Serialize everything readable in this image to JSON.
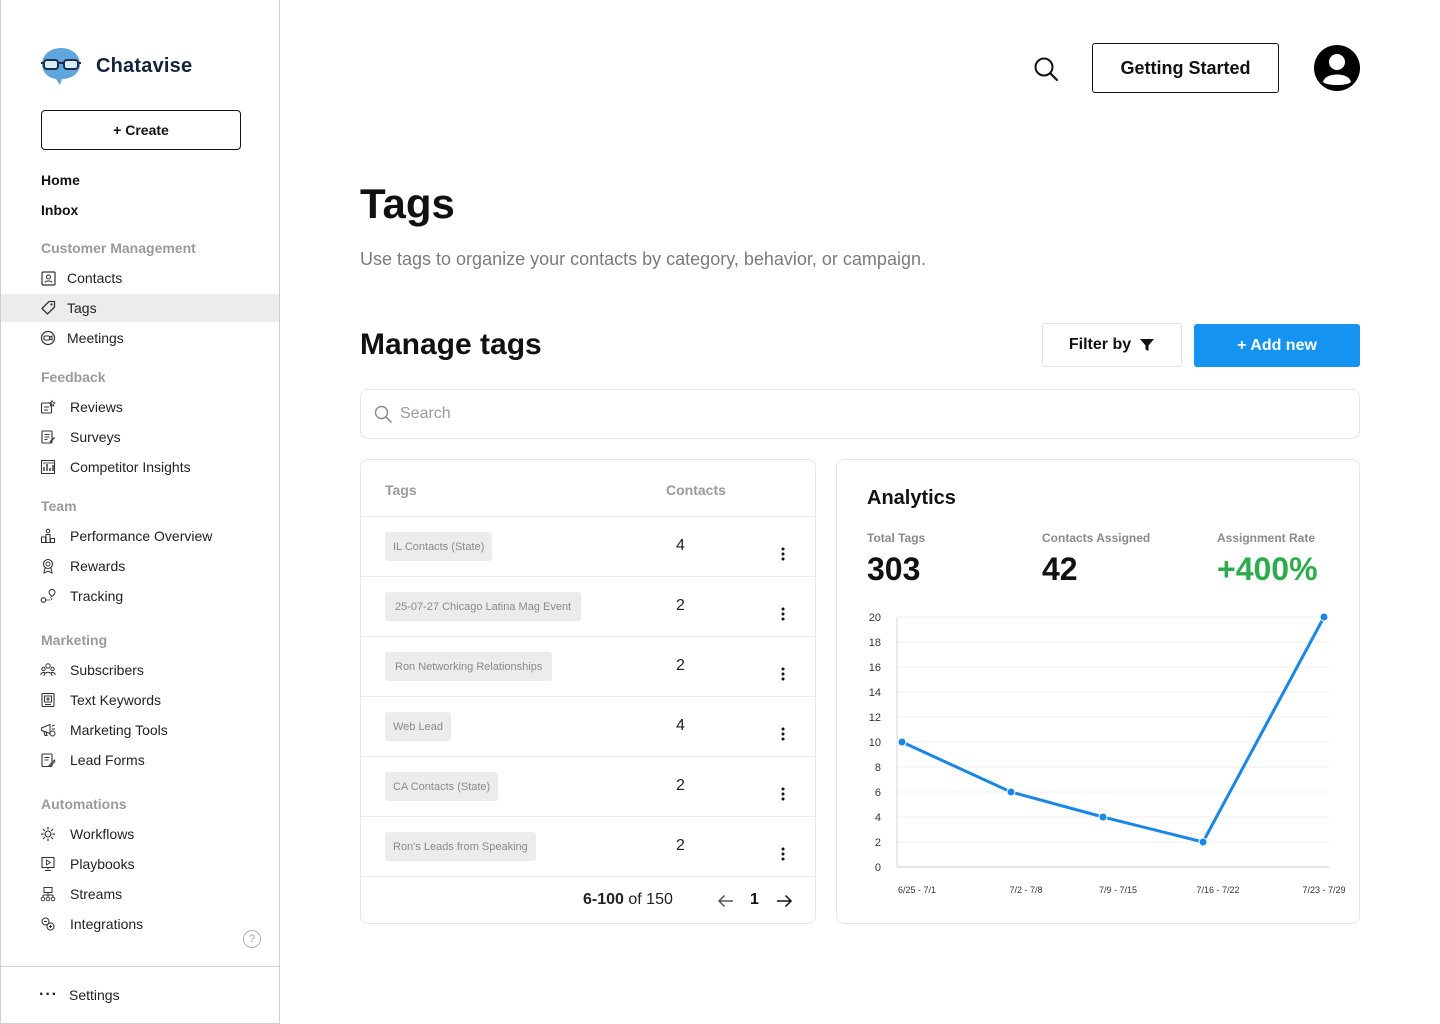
{
  "brand": {
    "name": "Chatavise"
  },
  "sidebar": {
    "create_label": "+ Create",
    "top_items": [
      "Home",
      "Inbox"
    ],
    "sections": [
      {
        "title": "Customer Management",
        "items": [
          {
            "label": "Contacts",
            "icon": "contacts-icon"
          },
          {
            "label": "Tags",
            "icon": "tag-icon",
            "active": true
          },
          {
            "label": "Meetings",
            "icon": "meetings-icon"
          }
        ]
      },
      {
        "title": "Feedback",
        "items": [
          {
            "label": "Reviews",
            "icon": "reviews-icon"
          },
          {
            "label": "Surveys",
            "icon": "surveys-icon"
          },
          {
            "label": "Competitor Insights",
            "icon": "competitor-insights-icon"
          }
        ]
      },
      {
        "title": "Team",
        "items": [
          {
            "label": "Performance Overview",
            "icon": "performance-icon"
          },
          {
            "label": "Rewards",
            "icon": "rewards-icon"
          },
          {
            "label": "Tracking",
            "icon": "tracking-icon"
          }
        ]
      },
      {
        "title": "Marketing",
        "items": [
          {
            "label": "Subscribers",
            "icon": "subscribers-icon"
          },
          {
            "label": "Text Keywords",
            "icon": "text-keywords-icon"
          },
          {
            "label": "Marketing Tools",
            "icon": "marketing-tools-icon"
          },
          {
            "label": "Lead Forms",
            "icon": "lead-forms-icon"
          }
        ]
      },
      {
        "title": "Automations",
        "items": [
          {
            "label": "Workflows",
            "icon": "workflows-icon"
          },
          {
            "label": "Playbooks",
            "icon": "playbooks-icon"
          },
          {
            "label": "Streams",
            "icon": "streams-icon"
          },
          {
            "label": "Integrations",
            "icon": "integrations-icon"
          }
        ]
      }
    ],
    "help_glyph": "?",
    "settings_label": "Settings",
    "settings_glyph": "···"
  },
  "header": {
    "getting_started_label": "Getting Started"
  },
  "main": {
    "title": "Tags",
    "subtitle": "Use tags to organize your contacts by category, behavior, or campaign.",
    "section_heading": "Manage tags",
    "filter_label": "Filter by",
    "add_label": "+ Add new",
    "search_placeholder": "Search"
  },
  "table": {
    "columns": [
      "Tags",
      "Contacts"
    ],
    "rows": [
      {
        "tag": "IL Contacts (State)",
        "contacts": "4"
      },
      {
        "tag": "25-07-27 Chicago Latina Mag Event",
        "contacts": "2"
      },
      {
        "tag": "Ron Networking Relationships",
        "contacts": "2"
      },
      {
        "tag": "Web Lead",
        "contacts": "4"
      },
      {
        "tag": "CA Contacts (State)",
        "contacts": "2"
      },
      {
        "tag": "Ron's Leads from Speaking",
        "contacts": "2"
      }
    ],
    "pagination": {
      "range": "6-100",
      "of_label": "of 150",
      "page": "1"
    }
  },
  "analytics": {
    "title": "Analytics",
    "stats": [
      {
        "label": "Total Tags",
        "value": "303"
      },
      {
        "label": "Contacts Assigned",
        "value": "42"
      },
      {
        "label": "Assignment Rate",
        "value": "+400%"
      }
    ]
  },
  "colors": {
    "accent": "#1593f0",
    "positive": "#2eab4c",
    "active_bg": "#ececec"
  },
  "chart_data": {
    "type": "line",
    "categories": [
      "6/25 - 7/1",
      "7/2 - 7/8",
      "7/9 - 7/15",
      "7/16 - 7/22",
      "7/23 - 7/29"
    ],
    "series": [
      {
        "values": [
          10,
          6,
          4,
          2,
          20
        ]
      }
    ],
    "yticks": [
      0,
      2,
      4,
      6,
      8,
      10,
      12,
      14,
      16,
      18,
      20
    ],
    "ylim": [
      0,
      20
    ],
    "grid": true,
    "line_color": "#1a87e4"
  }
}
